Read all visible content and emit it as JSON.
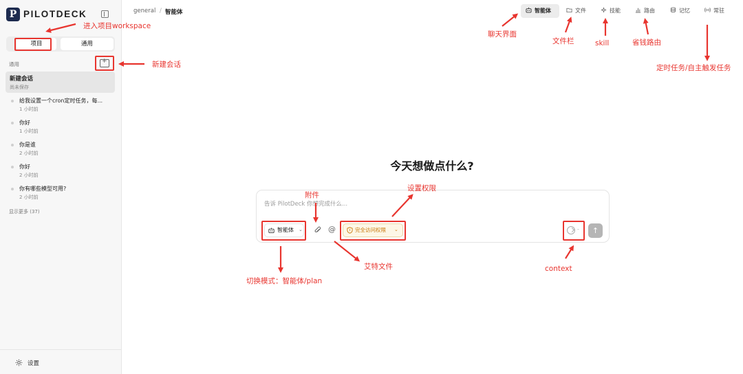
{
  "sidebar": {
    "logo_letter": "P",
    "brand": "PILOTDECK",
    "tabs": [
      {
        "label": "项目"
      },
      {
        "label": "通用"
      }
    ],
    "section_label": "通用",
    "current_chat": {
      "title": "新建会话",
      "subtitle": "尚未保存"
    },
    "history": [
      {
        "title": "给我设置一个cron定时任务，每...",
        "time": "1 小时前"
      },
      {
        "title": "你好",
        "time": "1 小时前"
      },
      {
        "title": "你是谁",
        "time": "2 小时前"
      },
      {
        "title": "你好",
        "time": "2 小时前"
      },
      {
        "title": "你有哪些模型可用?",
        "time": "2 小时前"
      }
    ],
    "show_more": "显示更多 (37)",
    "settings_label": "设置"
  },
  "header": {
    "breadcrumb_root": "general",
    "breadcrumb_sep": "/",
    "breadcrumb_current": "智能体",
    "nav": [
      {
        "label": "智能体",
        "icon": "bot-icon"
      },
      {
        "label": "文件",
        "icon": "folder-icon"
      },
      {
        "label": "技能",
        "icon": "sparkle-icon"
      },
      {
        "label": "路由",
        "icon": "bar-chart-icon"
      },
      {
        "label": "记忆",
        "icon": "database-icon"
      },
      {
        "label": "常驻",
        "icon": "broadcast-icon"
      }
    ]
  },
  "main": {
    "hero": "今天想做点什么?",
    "input_placeholder": "告诉 PilotDeck 你想完成什么...",
    "mode_label": "智能体",
    "permission_label": "完全访问权限",
    "context_dash": "-",
    "send_icon": "↑",
    "at_symbol": "@"
  },
  "annotations": {
    "workspace": "进入项目workspace",
    "new_chat": "新建会话",
    "chat_ui": "聊天界面",
    "files": "文件栏",
    "skill": "skill",
    "routing": "省钱路由",
    "scheduled": "定时任务/自主触发任务",
    "attachment": "附件",
    "permission": "设置权限",
    "switch_mode": "切换模式：智能体/plan",
    "at_file": "艾特文件",
    "context": "context"
  },
  "colors": {
    "annotation": "#e8352f",
    "brand_dark": "#1d2b4f",
    "permission_text": "#c9780a"
  }
}
